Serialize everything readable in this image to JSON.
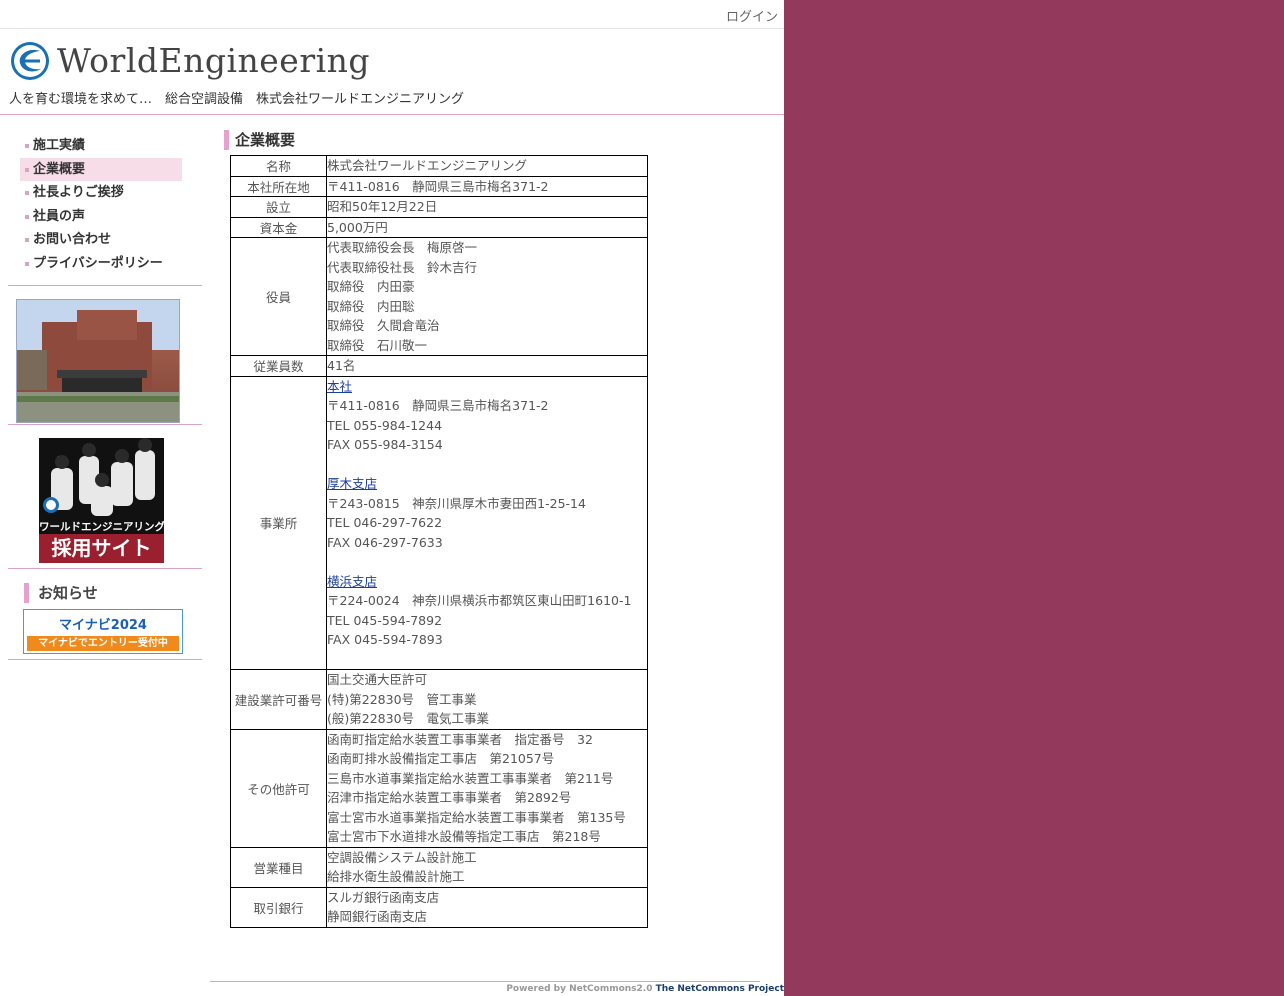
{
  "topbar": {
    "login_label": "ログイン"
  },
  "header": {
    "logo_text": "WorldEngineering",
    "tagline": "人を育む環境を求めて…　総合空調設備　株式会社ワールドエンジニアリング"
  },
  "nav": {
    "items": [
      {
        "label": "施工実績"
      },
      {
        "label": "企業概要"
      },
      {
        "label": "社長よりご挨拶"
      },
      {
        "label": "社員の声"
      },
      {
        "label": "お問い合わせ"
      },
      {
        "label": "プライバシーポリシー"
      }
    ],
    "active_index": 1
  },
  "recruit": {
    "line1": "ワールドエンジニアリング",
    "line2": "採用サイト"
  },
  "notice": {
    "title": "お知らせ",
    "mynavi_top": "マイナビ2024",
    "mynavi_bottom": "マイナビでエントリー受付中"
  },
  "main": {
    "title": "企業概要",
    "rows": {
      "name": {
        "label": "名称",
        "value": "株式会社ワールドエンジニアリング"
      },
      "hq": {
        "label": "本社所在地",
        "value": "〒411-0816　静岡県三島市梅名371-2"
      },
      "founded": {
        "label": "設立",
        "value": "昭和50年12月22日"
      },
      "capital": {
        "label": "資本金",
        "value": "5,000万円"
      },
      "officers": {
        "label": "役員",
        "lines": [
          "代表取締役会長　梅原啓一",
          "代表取締役社長　鈴木吉行",
          "取締役　内田豪",
          "取締役　内田聡",
          "取締役　久間倉竜治",
          "取締役　石川敬一"
        ]
      },
      "employees": {
        "label": "従業員数",
        "value": "41名"
      },
      "offices": {
        "label": "事業所",
        "branches": [
          {
            "name": "本社",
            "address": "〒411-0816　静岡県三島市梅名371-2",
            "tel": "TEL 055-984-1244",
            "fax": "FAX 055-984-3154"
          },
          {
            "name": "厚木支店",
            "address": "〒243-0815　神奈川県厚木市妻田西1-25-14",
            "tel": "TEL 046-297-7622",
            "fax": "FAX 046-297-7633"
          },
          {
            "name": "横浜支店",
            "address": "〒224-0024　神奈川県横浜市都筑区東山田町1610-1",
            "tel": "TEL 045-594-7892",
            "fax": "FAX 045-594-7893"
          }
        ]
      },
      "license": {
        "label": "建設業許可番号",
        "lines": [
          "国土交通大臣許可",
          "(特)第22830号　管工事業",
          "(般)第22830号　電気工事業"
        ]
      },
      "other_permits": {
        "label": "その他許可",
        "lines": [
          "函南町指定給水装置工事事業者　指定番号　32",
          "函南町排水設備指定工事店　第21057号",
          "三島市水道事業指定給水装置工事事業者　第211号",
          "沼津市指定給水装置工事事業者　第2892号",
          "富士宮市水道事業指定給水装置工事事業者　第135号",
          "富士宮市下水道排水設備等指定工事店　第218号"
        ]
      },
      "business": {
        "label": "営業種目",
        "lines": [
          "空調設備システム設計施工",
          "給排水衛生設備設計施工"
        ]
      },
      "banks": {
        "label": "取引銀行",
        "lines": [
          "スルガ銀行函南支店",
          "静岡銀行函南支店"
        ]
      }
    }
  },
  "footer": {
    "powered": "Powered by NetCommons2.0",
    "project": "The NetCommons Project"
  },
  "colors": {
    "accent_pink": "#e5a2cc",
    "outer_bg": "#933a5c",
    "link": "#1b3f9a"
  },
  "icons": {
    "logo": "world-engineering-logo-icon"
  }
}
